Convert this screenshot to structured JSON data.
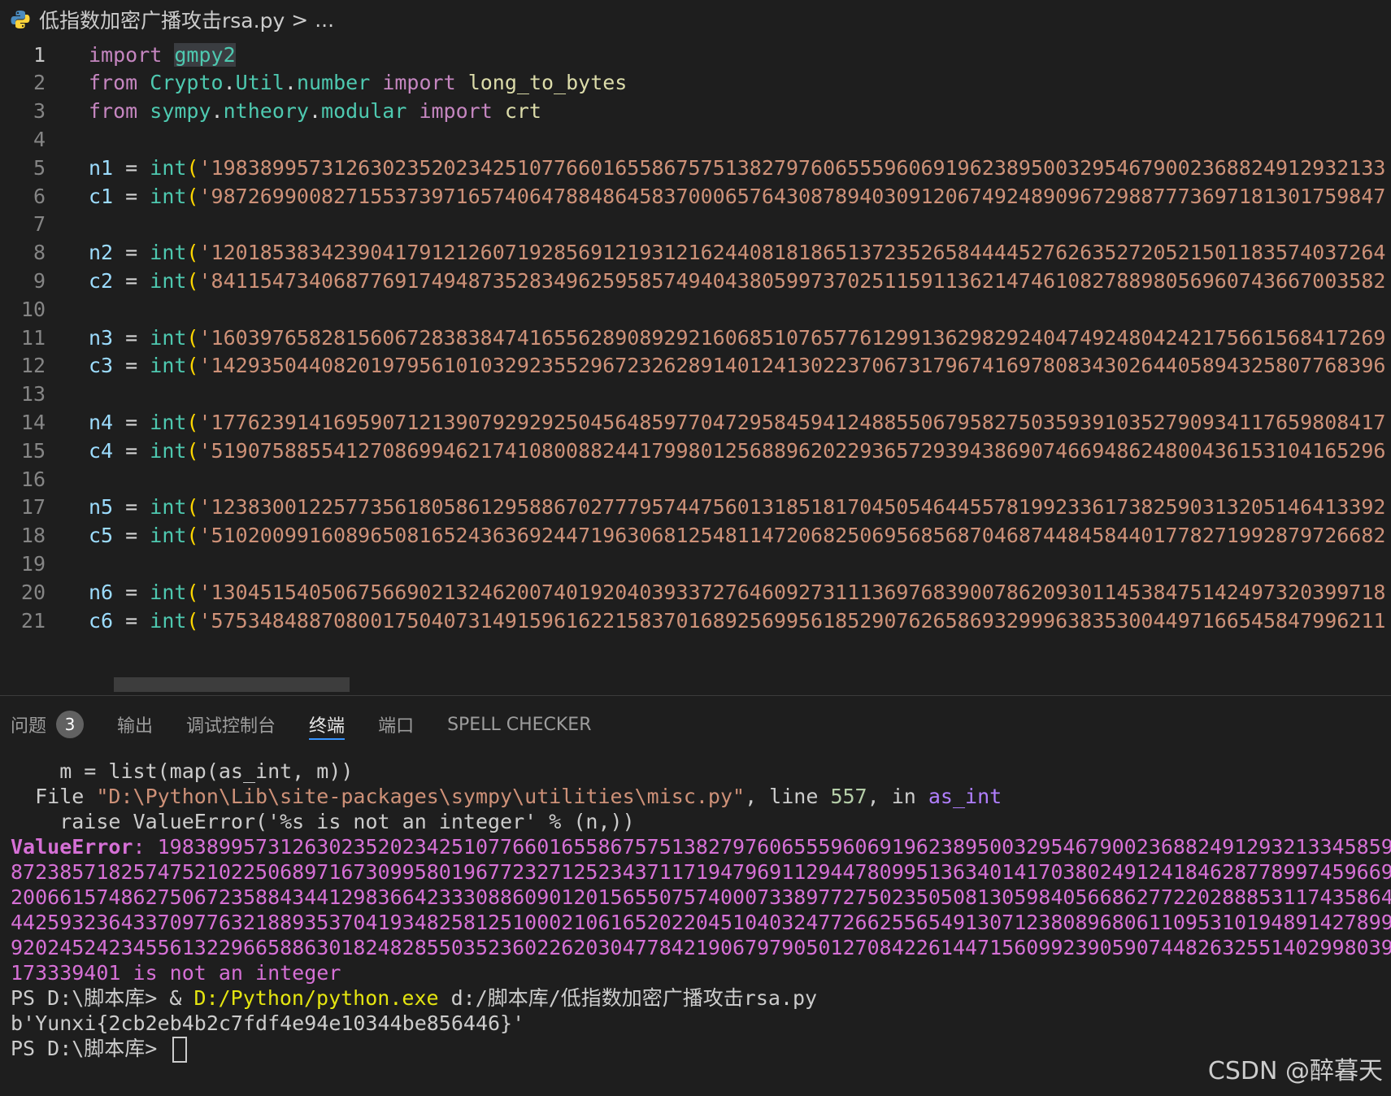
{
  "breadcrumb": {
    "file": "低指数加密广播攻击rsa.py",
    "separator": ">",
    "more": "..."
  },
  "editor": {
    "lines": [
      {
        "n": "1",
        "parts": [
          [
            "kw",
            "import"
          ],
          [
            "plain",
            " "
          ],
          [
            "mod",
            "gmpy2"
          ]
        ]
      },
      {
        "n": "2",
        "parts": [
          [
            "kw",
            "from"
          ],
          [
            "plain",
            " "
          ],
          [
            "mod",
            "Crypto"
          ],
          [
            "plain",
            "."
          ],
          [
            "mod",
            "Util"
          ],
          [
            "plain",
            "."
          ],
          [
            "mod",
            "number"
          ],
          [
            "plain",
            " "
          ],
          [
            "kw",
            "import"
          ],
          [
            "plain",
            " "
          ],
          [
            "fn",
            "long_to_bytes"
          ]
        ]
      },
      {
        "n": "3",
        "parts": [
          [
            "kw",
            "from"
          ],
          [
            "plain",
            " "
          ],
          [
            "mod",
            "sympy"
          ],
          [
            "plain",
            "."
          ],
          [
            "mod",
            "ntheory"
          ],
          [
            "plain",
            "."
          ],
          [
            "mod",
            "modular"
          ],
          [
            "plain",
            " "
          ],
          [
            "kw",
            "import"
          ],
          [
            "plain",
            " "
          ],
          [
            "fn",
            "crt"
          ]
        ]
      },
      {
        "n": "4",
        "parts": []
      },
      {
        "n": "5",
        "parts": [
          [
            "var",
            "n1"
          ],
          [
            "op",
            " = "
          ],
          [
            "mod",
            "int"
          ],
          [
            "paren",
            "("
          ],
          [
            "str",
            "'198389957312630235202342510776601655867575138279760655596069196238950032954679002368824912932133"
          ]
        ]
      },
      {
        "n": "6",
        "parts": [
          [
            "var",
            "c1"
          ],
          [
            "op",
            " = "
          ],
          [
            "mod",
            "int"
          ],
          [
            "paren",
            "("
          ],
          [
            "str",
            "'987269900827155373971657406478848645837000657643087894030912067492489096729887773697181301759847"
          ]
        ]
      },
      {
        "n": "7",
        "parts": []
      },
      {
        "n": "8",
        "parts": [
          [
            "var",
            "n2"
          ],
          [
            "op",
            " = "
          ],
          [
            "mod",
            "int"
          ],
          [
            "paren",
            "("
          ],
          [
            "str",
            "'120185383423904179121260719285691219312162440818186513723526584444527626352720521501183574037264"
          ]
        ]
      },
      {
        "n": "9",
        "parts": [
          [
            "var",
            "c2"
          ],
          [
            "op",
            " = "
          ],
          [
            "mod",
            "int"
          ],
          [
            "paren",
            "("
          ],
          [
            "str",
            "'841154734068776917494873528349625958574940438059973702511591136214746108278898056960743667003582"
          ]
        ]
      },
      {
        "n": "10",
        "parts": []
      },
      {
        "n": "11",
        "parts": [
          [
            "var",
            "n3"
          ],
          [
            "op",
            " = "
          ],
          [
            "mod",
            "int"
          ],
          [
            "paren",
            "("
          ],
          [
            "str",
            "'160397658281560672838384741655628908929216068510765776129913629829240474924804242175661568417269"
          ]
        ]
      },
      {
        "n": "12",
        "parts": [
          [
            "var",
            "c3"
          ],
          [
            "op",
            " = "
          ],
          [
            "mod",
            "int"
          ],
          [
            "paren",
            "("
          ],
          [
            "str",
            "'142935044082019795610103292355296723262891401241302237067317967416978083430264405894325807768396"
          ]
        ]
      },
      {
        "n": "13",
        "parts": []
      },
      {
        "n": "14",
        "parts": [
          [
            "var",
            "n4"
          ],
          [
            "op",
            " = "
          ],
          [
            "mod",
            "int"
          ],
          [
            "paren",
            "("
          ],
          [
            "str",
            "'177623914169590712139079292925045648597704729584594124885506795827503593910352790934117659808417"
          ]
        ]
      },
      {
        "n": "15",
        "parts": [
          [
            "var",
            "c4"
          ],
          [
            "op",
            " = "
          ],
          [
            "mod",
            "int"
          ],
          [
            "paren",
            "("
          ],
          [
            "str",
            "'519075885541270869946217410800882441799801256889620229365729394386907466948624800436153104165296"
          ]
        ]
      },
      {
        "n": "16",
        "parts": []
      },
      {
        "n": "17",
        "parts": [
          [
            "var",
            "n5"
          ],
          [
            "op",
            " = "
          ],
          [
            "mod",
            "int"
          ],
          [
            "paren",
            "("
          ],
          [
            "str",
            "'123830012257735618058612958867027779574475601318518170450546445578199233617382590313205146413392"
          ]
        ]
      },
      {
        "n": "18",
        "parts": [
          [
            "var",
            "c5"
          ],
          [
            "op",
            " = "
          ],
          [
            "mod",
            "int"
          ],
          [
            "paren",
            "("
          ],
          [
            "str",
            "'510200991608965081652436369244719630681254811472068250695685687046874484584401778271992879726682"
          ]
        ]
      },
      {
        "n": "19",
        "parts": []
      },
      {
        "n": "20",
        "parts": [
          [
            "var",
            "n6"
          ],
          [
            "op",
            " = "
          ],
          [
            "mod",
            "int"
          ],
          [
            "paren",
            "("
          ],
          [
            "str",
            "'130451540506756690213246200740192040393372764609273111369768390078620930114538475142497320399718"
          ]
        ]
      },
      {
        "n": "21",
        "parts": [
          [
            "var",
            "c6"
          ],
          [
            "op",
            " = "
          ],
          [
            "mod",
            "int"
          ],
          [
            "paren",
            "("
          ],
          [
            "str",
            "'575348488708001750407314915961622158370168925699561852907626586932999638353004497166545847996211"
          ]
        ]
      }
    ]
  },
  "panel": {
    "tabs": [
      {
        "label": "问题",
        "badge": "3"
      },
      {
        "label": "输出"
      },
      {
        "label": "调试控制台"
      },
      {
        "label": "终端",
        "active": true
      },
      {
        "label": "端口"
      },
      {
        "label": "SPELL CHECKER"
      }
    ]
  },
  "terminal": {
    "lines": [
      [
        [
          "t-plain",
          "    m = list(map(as_int, m))"
        ]
      ],
      [
        [
          "t-plain",
          "  File "
        ],
        [
          "t-str",
          "\"D:\\Python\\Lib\\site-packages\\sympy\\utilities\\misc.py\""
        ],
        [
          "t-plain",
          ", line "
        ],
        [
          "t-num",
          "557"
        ],
        [
          "t-plain",
          ", in "
        ],
        [
          "t-purple",
          "as_int"
        ]
      ],
      [
        [
          "t-plain",
          "    raise ValueError('%s is not an integer' % (n,))"
        ]
      ],
      [
        [
          "t-err",
          "ValueError"
        ],
        [
          "t-magenta",
          ": 198389957312630235202342510776601655867575138279760655596069196238950032954679002368824912932133458598"
        ]
      ],
      [
        [
          "t-magenta",
          "872385718257475210225068971673099580196772327125234371171947969112944780995136340141703802491241846287789974596693"
        ]
      ],
      [
        [
          "t-magenta",
          "200661574862750672358843441298366423330886090120156550757400073389772750235050813059840566862772202888531174358645"
        ]
      ],
      [
        [
          "t-magenta",
          "442593236433709776321889353704193482581251000210616520220451040324772662556549130712380896806110953101948914278995"
        ]
      ],
      [
        [
          "t-magenta",
          "920245242345561322966588630182482855035236022620304778421906797905012708422614471560992390590744826325514029980399"
        ]
      ],
      [
        [
          "t-magenta",
          "173339401 is not an integer"
        ]
      ],
      [
        [
          "t-plain",
          "PS D:\\脚本库> & "
        ],
        [
          "t-path",
          "D:/Python/python.exe"
        ],
        [
          "t-plain",
          " d:/脚本库/低指数加密广播攻击rsa.py"
        ]
      ],
      [
        [
          "t-plain",
          "b'Yunxi{2cb2eb4b2c7fdf4e94e10344be856446}'"
        ]
      ],
      [
        [
          "t-plain",
          "PS D:\\脚本库> "
        ]
      ]
    ]
  },
  "watermark": "CSDN @醉暮天"
}
